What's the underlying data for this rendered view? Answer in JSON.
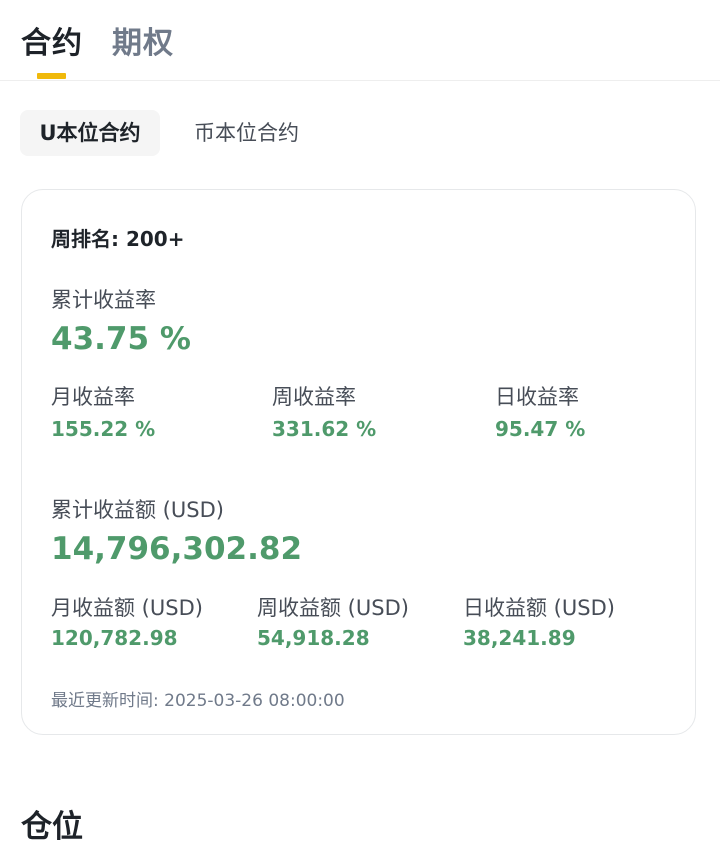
{
  "tabs": [
    "合约",
    "期权"
  ],
  "segments": [
    "U本位合约",
    "币本位合约"
  ],
  "card": {
    "rank_label": "周排名: 200+",
    "cum_rate_label": "累计收益率",
    "cum_rate_value": "43.75 %",
    "month_rate_label": "月收益率",
    "month_rate_value": "155.22 %",
    "week_rate_label": "周收益率",
    "week_rate_value": "331.62 %",
    "day_rate_label": "日收益率",
    "day_rate_value": "95.47 %",
    "cum_amount_label": "累计收益额 (USD)",
    "cum_amount_value": "14,796,302.82",
    "month_amount_label": "月收益额 (USD)",
    "month_amount_value": "120,782.98",
    "week_amount_label": "周收益额 (USD)",
    "week_amount_value": "54,918.28",
    "day_amount_label": "日收益额 (USD)",
    "day_amount_value": "38,241.89",
    "updated_label": "最近更新时间: 2025-03-26 08:00:00"
  },
  "section_title": "仓位",
  "colors": {
    "accent_yellow": "#f0b90b",
    "profit_green": "#4f9a6b"
  }
}
